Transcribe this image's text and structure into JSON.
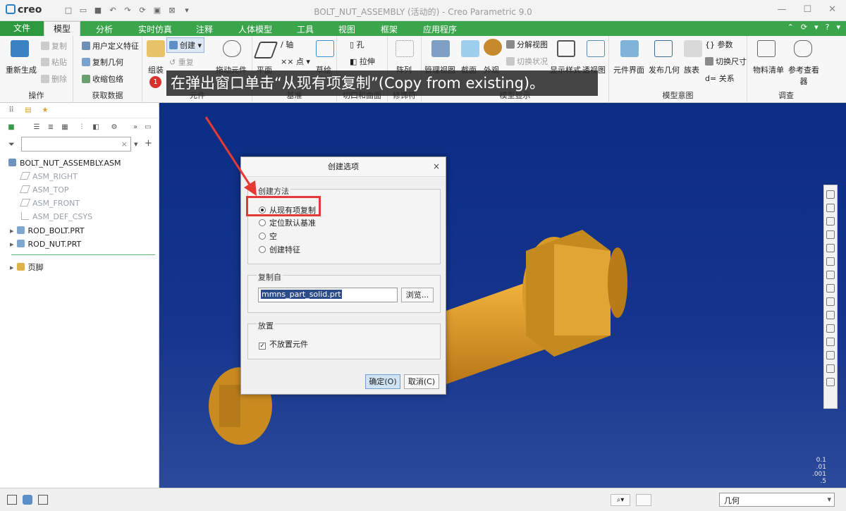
{
  "app": {
    "logo": "creo",
    "window_title": "BOLT_NUT_ASSEMBLY (活动的) - Creo Parametric 9.0"
  },
  "tabs": [
    "文件",
    "模型",
    "分析",
    "实时仿真",
    "注释",
    "人体模型",
    "工具",
    "视图",
    "框架",
    "应用程序"
  ],
  "ribbon": {
    "operations": {
      "regenerate": "重新生成",
      "copy": "复制",
      "paste": "粘贴",
      "delete": "删除",
      "group": "操作"
    },
    "get_data": {
      "udf": "用户定义特征",
      "copy_geom": "复制几何",
      "shrinkwrap": "收缩包络",
      "group": "获取数据"
    },
    "component": {
      "assemble": "组装",
      "create": "创建",
      "repeat": "重复",
      "drag": "拖动元件",
      "group": "元件"
    },
    "datum": {
      "axis": "轴",
      "plane": "平面",
      "point": "点",
      "sketch": "草绘",
      "group": "基准"
    },
    "cut_surface": {
      "hole": "孔",
      "extrude": "拉伸",
      "group": "切口和曲面"
    },
    "modifiers": {
      "pattern": "阵列",
      "group": "修饰符"
    },
    "model_display": {
      "manage_views": "管理视图",
      "section": "截面",
      "appearance": "外观",
      "explode": "分解视图",
      "toggle": "切换状况",
      "display_style": "显示样式",
      "perspective": "透视图",
      "group": "模型显示"
    },
    "model_intent": {
      "comp_interface": "元件界面",
      "publish_geom": "发布几何",
      "family_table": "族表",
      "parameters": "参数",
      "switch_dims": "切换尺寸",
      "relations": "关系",
      "group": "模型意图"
    },
    "investigate": {
      "bom": "物料清单",
      "ref_viewer": "参考查看器",
      "group": "调查"
    }
  },
  "caption": {
    "badge": "1",
    "text": "在弹出窗口单击“从现有项复制”(Copy from existing)。"
  },
  "model_tree": {
    "filter_placeholder": "",
    "items": [
      {
        "label": "BOLT_NUT_ASSEMBLY.ASM",
        "kind": "asm"
      },
      {
        "label": "ASM_RIGHT",
        "kind": "datum"
      },
      {
        "label": "ASM_TOP",
        "kind": "datum"
      },
      {
        "label": "ASM_FRONT",
        "kind": "datum"
      },
      {
        "label": "ASM_DEF_CSYS",
        "kind": "datum"
      },
      {
        "label": "ROD_BOLT.PRT",
        "kind": "part"
      },
      {
        "label": "ROD_NUT.PRT",
        "kind": "part"
      },
      {
        "label": "页脚",
        "kind": "footer"
      }
    ]
  },
  "dialog": {
    "title": "创建选项",
    "method_label": "创建方法",
    "options": [
      "从现有项复制",
      "定位默认基准",
      "空",
      "创建特征"
    ],
    "selected_option": "从现有项复制",
    "copy_from_label": "复制自",
    "copy_from_value": "mmns_part_solid.prt",
    "browse": "浏览...",
    "placement_label": "放置",
    "no_place_checkbox": "不放置元件",
    "no_place_checked": true,
    "ok": "确定(O)",
    "cancel": "取消(C)"
  },
  "viewport": {
    "tolerance_lines": [
      "0.1",
      ".01",
      ".001",
      ".5"
    ]
  },
  "status_bar": {
    "filter_value": "几何"
  }
}
